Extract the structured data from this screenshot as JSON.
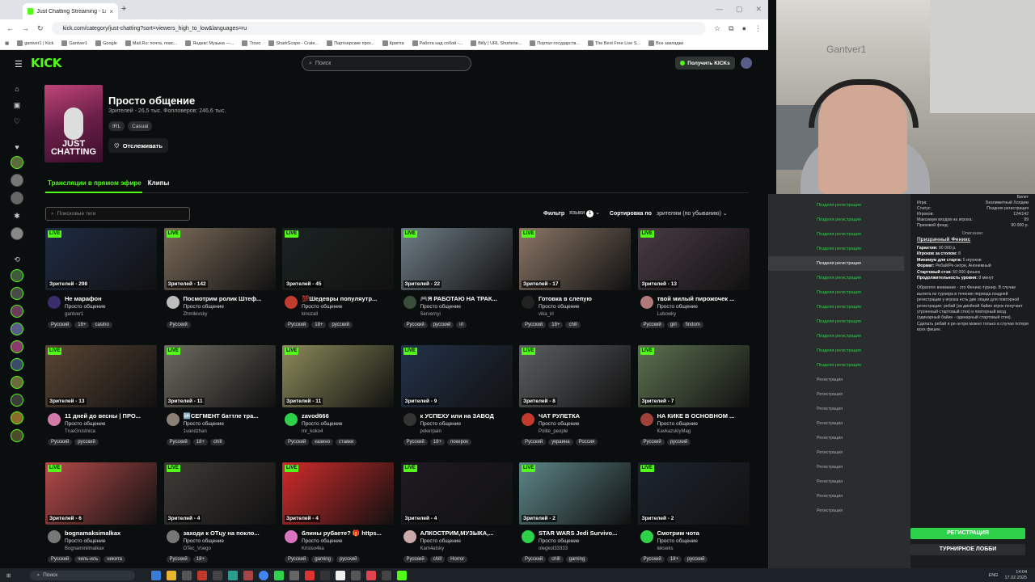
{
  "browser": {
    "tab_title": "Just Chatting Streaming - Live",
    "url": "kick.com/category/just-chatting?sort=viewers_high_to_low&languages=ru",
    "bookmarks": [
      "gantver1 | Kick",
      "Gantver1",
      "Google",
      "Mail.Ru: почта, поис...",
      "Яндекс Музыка —...",
      "Trovo",
      "SharkScope - Crate...",
      "Партнерские прог...",
      "Криптa",
      "Работа над собой -...",
      "Bitly | URL Shortene...",
      "Портал государств...",
      "The Best Free Live S...",
      "Все закладки"
    ]
  },
  "header": {
    "logo": "KICK",
    "search_placeholder": "Поиск",
    "kicks_button": "Получить KICKs"
  },
  "category": {
    "title": "Просто общение",
    "stats": "Зрителей - 26,5 тыс.   Фолловеров: 246,6 тыс.",
    "tags": [
      "IRL",
      "Casual"
    ],
    "follow_label": "Отслеживать",
    "image_text": "JUST CHATTING"
  },
  "tabs": {
    "live": "Трансляции в прямом эфире",
    "clips": "Клипы"
  },
  "filters": {
    "tag_search_placeholder": "Поисковые теги",
    "filter_label": "Фильтр",
    "languages_label": "языки",
    "languages_count": "1",
    "sort_label": "Сортировка по",
    "sort_value": "зрителям (по убыванию)"
  },
  "live_badge": "LIVE",
  "streams": [
    {
      "title": "Не марафон",
      "category": "Просто общение",
      "name": "gantver1",
      "viewers": "Зрителей - 298",
      "tags": [
        "Русский",
        "18+",
        "casino"
      ],
      "color": "#1f2b44",
      "av": "#3b2d6b"
    },
    {
      "title": "Посмотрим ролик Штеф...",
      "category": "Просто общение",
      "name": "Zhmilevsky",
      "viewers": "Зрителей - 142",
      "tags": [
        "Русский"
      ],
      "color": "#7a6a58",
      "av": "#bdbdbd"
    },
    {
      "title": "💯Шедевры популяутр...",
      "category": "Просто общение",
      "name": "kinozall",
      "viewers": "Зрителей - 45",
      "tags": [
        "Русский",
        "18+",
        "русский"
      ],
      "color": "#1b2322",
      "av": "#c33a2e"
    },
    {
      "title": "🎮Я РАБОТАЮ НА ТРАК...",
      "category": "Просто общение",
      "name": "Servernyi",
      "viewers": "Зрителей - 22",
      "tags": [
        "Русский",
        "русский",
        "irl"
      ],
      "color": "#6f7d86",
      "av": "#3a4f3b"
    },
    {
      "title": "Готовка в слепую",
      "category": "Просто общение",
      "name": "vika_iri",
      "viewers": "Зрителей - 17",
      "tags": [
        "Русский",
        "18+",
        "chill"
      ],
      "color": "#8b7666",
      "av": "#222"
    },
    {
      "title": "твой милый пирожочек ...",
      "category": "Просто общение",
      "name": "Lubowky",
      "viewers": "Зрителей - 13",
      "tags": [
        "Русский",
        "girl",
        "findom"
      ],
      "color": "#4a3b45",
      "av": "#b07a7a"
    },
    {
      "title": "11 дней до весны | ПРО...",
      "category": "Просто общение",
      "name": "TrueGrustnica",
      "viewers": "Зрителей - 13",
      "tags": [
        "Русский",
        "русский"
      ],
      "color": "#5a4534",
      "av": "#d27aa8"
    },
    {
      "title": "🆙СЕГМЕНТ баттле тра...",
      "category": "Просто общение",
      "name": "1vandzhan",
      "viewers": "Зрителей - 11",
      "tags": [
        "Русский",
        "18+",
        "chill"
      ],
      "color": "#6d6a5f",
      "av": "#8c7f76"
    },
    {
      "title": "zavod666",
      "category": "Просто общение",
      "name": "mr_koko4",
      "viewers": "Зрителей - 11",
      "tags": [
        "Русский",
        "казино",
        "ставки"
      ],
      "color": "#8c8b5a",
      "av": "#2ed14a"
    },
    {
      "title": "к УСПЕХУ или на ЗАВОД",
      "category": "Просто общение",
      "name": "pokerpain",
      "viewers": "Зрителей - 9",
      "tags": [
        "Русский",
        "18+",
        "покерок"
      ],
      "color": "#23324a",
      "av": "#333"
    },
    {
      "title": "ЧАТ РУЛЕТКА",
      "category": "Просто общение",
      "name": "Polite_people",
      "viewers": "Зрителей - 8",
      "tags": [
        "Русский",
        "украина",
        "Россия"
      ],
      "color": "#5c5f62",
      "av": "#c23a2e"
    },
    {
      "title": "НА КИКЕ В ОСНОВНОМ ...",
      "category": "Просто общение",
      "name": "KavkazskiyMag",
      "viewers": "Зрителей - 7",
      "tags": [
        "Русский",
        "русский"
      ],
      "color": "#5d7251",
      "av": "#a0413a"
    },
    {
      "title": "bognamaksimalkax",
      "category": "Просто общение",
      "name": "Bognaminilmalkax",
      "viewers": "Зрителей - 6",
      "tags": [
        "Русский",
        "чиль-иль",
        "никита"
      ],
      "color": "#b54a4a",
      "av": "#777"
    },
    {
      "title": "заходи к ОТцу на покло...",
      "category": "Просто общение",
      "name": "OTec_Vsego",
      "viewers": "Зрителей - 4",
      "tags": [
        "Русский",
        "18+"
      ],
      "color": "#3e3a36",
      "av": "#777"
    },
    {
      "title": "блины рубаете? 🎁 https...",
      "category": "Просто общение",
      "name": "Krisiso4ka",
      "viewers": "Зрителей - 4",
      "tags": [
        "Русский",
        "gaming",
        "русский"
      ],
      "color": "#d22b2b",
      "av": "#d873c0"
    },
    {
      "title": "АЛКОСТРИМ,МУЗЫКА,...",
      "category": "Просто общение",
      "name": "Kam4atsky",
      "viewers": "Зрителей - 4",
      "tags": [
        "Русский",
        "chill",
        "Horror"
      ],
      "color": "#1e1a22",
      "av": "#caa"
    },
    {
      "title": "STAR WARS Jedi Survivo...",
      "category": "Просто общение",
      "name": "olegkot33333",
      "viewers": "Зрителей - 2",
      "tags": [
        "Русский",
        "chill",
        "gaming"
      ],
      "color": "#5d8688",
      "av": "#2ed14a"
    },
    {
      "title": "Смотрим чота",
      "category": "Просто общение",
      "name": "lekseks",
      "viewers": "Зрителей - 2",
      "tags": [
        "Русский",
        "18+",
        "русский"
      ],
      "color": "#1d2530",
      "av": "#2ed14a"
    }
  ],
  "tournament": {
    "header": "Билет",
    "rows": [
      [
        "Игра:",
        "Безлимитный Холдем"
      ],
      [
        "Статус:",
        "Поздняя регистрация"
      ],
      [
        "Игроков:",
        "124/142"
      ],
      [
        "Максимум входов на игрока:",
        "99"
      ],
      [
        "Призовой фонд:",
        "90 000 р."
      ]
    ],
    "desc_label": "Описание:",
    "name": "Призрачный Феникс",
    "info": [
      [
        "Гарантия:",
        "90 000 р."
      ],
      [
        "Игроков за столом:",
        "8"
      ],
      [
        "Минимум для старта:",
        "5 игроков"
      ],
      [
        "Формат:",
        "Ребай/Ре-энтри, Анонимный"
      ],
      [
        "Стартовый стэк:",
        "50 000 фишек"
      ],
      [
        "Продолжительность уровня:",
        "8 минут"
      ]
    ],
    "note": "Обратите внимание - это Феникс-турнир. В случае вылета из турнира в течение периода поздней регистрации у игрока есть две опции для повторной регистрации: ребай (за двойной байин игрок получает утроенный стартовый стек) и повторный вход (одинарный байин - одинарный стартовый стек). Сделать ребай и ре-энтри можно только в случае потери всех фишек.",
    "register_button": "РЕГИСТРАЦИЯ",
    "lobby_button": "ТУРНИРНОЕ ЛОББИ"
  },
  "reg_list": [
    {
      "label": "Поздняя регистрация",
      "type": "late"
    },
    {
      "label": "Поздняя регистрация",
      "type": "late"
    },
    {
      "label": "Поздняя регистрация",
      "type": "late"
    },
    {
      "label": "Поздняя регистрация",
      "type": "late"
    },
    {
      "label": "Поздняя регистрация",
      "type": "sel"
    },
    {
      "label": "Поздняя регистрация",
      "type": "late"
    },
    {
      "label": "Поздняя регистрация",
      "type": "late"
    },
    {
      "label": "Поздняя регистрация",
      "type": "late"
    },
    {
      "label": "Поздняя регистрация",
      "type": "late"
    },
    {
      "label": "Поздняя регистрация",
      "type": "late"
    },
    {
      "label": "Поздняя регистрация",
      "type": "late"
    },
    {
      "label": "Поздняя регистрация",
      "type": "late"
    },
    {
      "label": "Регистрация",
      "type": "reg"
    },
    {
      "label": "Регистрация",
      "type": "reg"
    },
    {
      "label": "Регистрация",
      "type": "reg"
    },
    {
      "label": "Регистрация",
      "type": "reg"
    },
    {
      "label": "Регистрация",
      "type": "reg"
    },
    {
      "label": "Регистрация",
      "type": "reg"
    },
    {
      "label": "Регистрация",
      "type": "reg"
    },
    {
      "label": "Регистрация",
      "type": "reg"
    },
    {
      "label": "Регистрация",
      "type": "reg"
    },
    {
      "label": "Регистрация",
      "type": "reg"
    }
  ],
  "webcam": {
    "watermark": "Gantver1"
  },
  "taskbar": {
    "search_placeholder": "Поиск",
    "lang": "ENG",
    "time": "14:04",
    "date": "17.02.2025"
  },
  "colors": {
    "accent": "#53fc18",
    "register": "#2ed14a"
  }
}
